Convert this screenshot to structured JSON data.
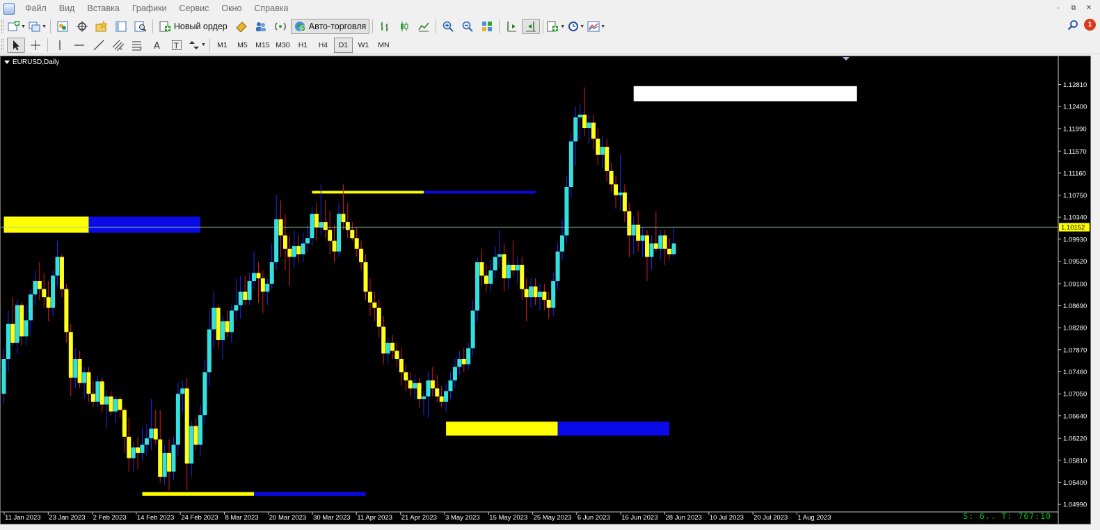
{
  "menu": {
    "items": [
      "Файл",
      "Вид",
      "Вставка",
      "Графики",
      "Сервис",
      "Окно",
      "Справка"
    ]
  },
  "window_controls": {
    "minimize": "–",
    "restore": "⧉",
    "close": "✕"
  },
  "toolbar": {
    "new_order_label": "Новый ордер",
    "auto_trading_label": "Авто-торговля",
    "notification_count": "1"
  },
  "timeframes": [
    "M1",
    "M5",
    "M15",
    "M30",
    "H1",
    "H4",
    "D1",
    "W1",
    "MN"
  ],
  "active_timeframe": "D1",
  "chart": {
    "title": "EURUSD,Daily",
    "status_readout": "S: 6.. T: 767:10"
  },
  "chart_data": {
    "type": "candlestick",
    "symbol": "EURUSD",
    "period": "Daily",
    "current_price": 1.10152,
    "current_price_label": "1.10152",
    "y_range": [
      1.0494,
      1.1318
    ],
    "y_ticks": [
      "1.12810",
      "1.12400",
      "1.11990",
      "1.11570",
      "1.11160",
      "1.10750",
      "1.10340",
      "1.09930",
      "1.09520",
      "1.09100",
      "1.08690",
      "1.08280",
      "1.07870",
      "1.07460",
      "1.07050",
      "1.06640",
      "1.06220",
      "1.05810",
      "1.05400",
      "1.04990"
    ],
    "x_ticks": [
      "11 Jan 2023",
      "23 Jan 2023",
      "2 Feb 2023",
      "14 Feb 2023",
      "24 Feb 2023",
      "8 Mar 2023",
      "20 Mar 2023",
      "30 Mar 2023",
      "11 Apr 2023",
      "21 Apr 2023",
      "3 May 2023",
      "15 May 2023",
      "25 May 2023",
      "6 Jun 2023",
      "16 Jun 2023",
      "28 Jun 2023",
      "10 Jul 2023",
      "20 Jul 2023",
      "1 Aug 2023"
    ],
    "colors": {
      "background": "#000000",
      "bull_body": "#33e0e0",
      "bear_body": "#ffff1a",
      "bull_wick": "#1a2bff",
      "bear_wick": "#e01a1a",
      "price_line": "#9ed49e",
      "zone_yellow": "#ffff00",
      "zone_blue": "#0a0ae6",
      "zone_white": "#ffffff",
      "readout": "#00c400"
    },
    "candles": [
      {
        "o": 1.0705,
        "h": 1.079,
        "l": 1.0685,
        "c": 1.077
      },
      {
        "o": 1.077,
        "h": 1.086,
        "l": 1.0745,
        "c": 1.0835
      },
      {
        "o": 1.0835,
        "h": 1.0885,
        "l": 1.0795,
        "c": 1.08
      },
      {
        "o": 1.08,
        "h": 1.088,
        "l": 1.078,
        "c": 1.087
      },
      {
        "o": 1.087,
        "h": 1.0875,
        "l": 1.0795,
        "c": 1.0812
      },
      {
        "o": 1.0812,
        "h": 1.087,
        "l": 1.0795,
        "c": 1.0842
      },
      {
        "o": 1.0842,
        "h": 1.09,
        "l": 1.0815,
        "c": 1.089
      },
      {
        "o": 1.089,
        "h": 1.0935,
        "l": 1.087,
        "c": 1.0915
      },
      {
        "o": 1.0915,
        "h": 1.095,
        "l": 1.088,
        "c": 1.09
      },
      {
        "o": 1.09,
        "h": 1.093,
        "l": 1.0865,
        "c": 1.0885
      },
      {
        "o": 1.0885,
        "h": 1.0915,
        "l": 1.084,
        "c": 1.0865
      },
      {
        "o": 1.0865,
        "h": 1.0935,
        "l": 1.085,
        "c": 1.0925
      },
      {
        "o": 1.0925,
        "h": 1.099,
        "l": 1.0905,
        "c": 1.096
      },
      {
        "o": 1.096,
        "h": 1.0965,
        "l": 1.0885,
        "c": 1.09
      },
      {
        "o": 1.09,
        "h": 1.091,
        "l": 1.08,
        "c": 1.082
      },
      {
        "o": 1.082,
        "h": 1.0835,
        "l": 1.07,
        "c": 1.0735
      },
      {
        "o": 1.0735,
        "h": 1.079,
        "l": 1.0715,
        "c": 1.077
      },
      {
        "o": 1.077,
        "h": 1.0785,
        "l": 1.0715,
        "c": 1.0725
      },
      {
        "o": 1.0725,
        "h": 1.0755,
        "l": 1.0695,
        "c": 1.0745
      },
      {
        "o": 1.0745,
        "h": 1.0755,
        "l": 1.069,
        "c": 1.0705
      },
      {
        "o": 1.0705,
        "h": 1.073,
        "l": 1.068,
        "c": 1.069
      },
      {
        "o": 1.069,
        "h": 1.074,
        "l": 1.068,
        "c": 1.0728
      },
      {
        "o": 1.0728,
        "h": 1.0735,
        "l": 1.067,
        "c": 1.0685
      },
      {
        "o": 1.0685,
        "h": 1.0712,
        "l": 1.064,
        "c": 1.07
      },
      {
        "o": 1.07,
        "h": 1.071,
        "l": 1.0665,
        "c": 1.0672
      },
      {
        "o": 1.0672,
        "h": 1.07,
        "l": 1.065,
        "c": 1.0695
      },
      {
        "o": 1.0695,
        "h": 1.07,
        "l": 1.066,
        "c": 1.0675
      },
      {
        "o": 1.0675,
        "h": 1.068,
        "l": 1.0595,
        "c": 1.0625
      },
      {
        "o": 1.0625,
        "h": 1.066,
        "l": 1.056,
        "c": 1.0585
      },
      {
        "o": 1.0585,
        "h": 1.0615,
        "l": 1.056,
        "c": 1.0605
      },
      {
        "o": 1.0605,
        "h": 1.0625,
        "l": 1.0565,
        "c": 1.0595
      },
      {
        "o": 1.0595,
        "h": 1.064,
        "l": 1.058,
        "c": 1.061
      },
      {
        "o": 1.061,
        "h": 1.065,
        "l": 1.059,
        "c": 1.0622
      },
      {
        "o": 1.0622,
        "h": 1.0695,
        "l": 1.06,
        "c": 1.064
      },
      {
        "o": 1.064,
        "h": 1.0675,
        "l": 1.061,
        "c": 1.062
      },
      {
        "o": 1.062,
        "h": 1.0675,
        "l": 1.054,
        "c": 1.055
      },
      {
        "o": 1.055,
        "h": 1.061,
        "l": 1.0535,
        "c": 1.0595
      },
      {
        "o": 1.0595,
        "h": 1.062,
        "l": 1.0525,
        "c": 1.056
      },
      {
        "o": 1.056,
        "h": 1.0625,
        "l": 1.0545,
        "c": 1.061
      },
      {
        "o": 1.061,
        "h": 1.0725,
        "l": 1.059,
        "c": 1.0705
      },
      {
        "o": 1.0705,
        "h": 1.073,
        "l": 1.067,
        "c": 1.0715
      },
      {
        "o": 1.0715,
        "h": 1.0735,
        "l": 1.0525,
        "c": 1.0575
      },
      {
        "o": 1.0575,
        "h": 1.0655,
        "l": 1.055,
        "c": 1.0645
      },
      {
        "o": 1.0645,
        "h": 1.066,
        "l": 1.06,
        "c": 1.061
      },
      {
        "o": 1.061,
        "h": 1.0685,
        "l": 1.059,
        "c": 1.0665
      },
      {
        "o": 1.0665,
        "h": 1.077,
        "l": 1.065,
        "c": 1.0745
      },
      {
        "o": 1.0745,
        "h": 1.086,
        "l": 1.072,
        "c": 1.0825
      },
      {
        "o": 1.0825,
        "h": 1.0895,
        "l": 1.079,
        "c": 1.0865
      },
      {
        "o": 1.0865,
        "h": 1.087,
        "l": 1.079,
        "c": 1.0805
      },
      {
        "o": 1.0805,
        "h": 1.085,
        "l": 1.077,
        "c": 1.084
      },
      {
        "o": 1.084,
        "h": 1.086,
        "l": 1.081,
        "c": 1.082
      },
      {
        "o": 1.082,
        "h": 1.087,
        "l": 1.08,
        "c": 1.086
      },
      {
        "o": 1.086,
        "h": 1.092,
        "l": 1.084,
        "c": 1.087
      },
      {
        "o": 1.087,
        "h": 1.0925,
        "l": 1.0845,
        "c": 1.0895
      },
      {
        "o": 1.0895,
        "h": 1.0925,
        "l": 1.087,
        "c": 1.088
      },
      {
        "o": 1.088,
        "h": 1.093,
        "l": 1.087,
        "c": 1.0915
      },
      {
        "o": 1.0915,
        "h": 1.097,
        "l": 1.09,
        "c": 1.093
      },
      {
        "o": 1.093,
        "h": 1.095,
        "l": 1.0875,
        "c": 1.092
      },
      {
        "o": 1.092,
        "h": 1.0935,
        "l": 1.0855,
        "c": 1.0895
      },
      {
        "o": 1.0895,
        "h": 1.092,
        "l": 1.087,
        "c": 1.091
      },
      {
        "o": 1.091,
        "h": 1.0985,
        "l": 1.09,
        "c": 1.095
      },
      {
        "o": 1.095,
        "h": 1.1075,
        "l": 1.0935,
        "c": 1.103
      },
      {
        "o": 1.103,
        "h": 1.1065,
        "l": 1.096,
        "c": 1.1
      },
      {
        "o": 1.1,
        "h": 1.104,
        "l": 1.0935,
        "c": 1.0975
      },
      {
        "o": 1.0975,
        "h": 1.1,
        "l": 1.0905,
        "c": 1.096
      },
      {
        "o": 1.096,
        "h": 1.101,
        "l": 1.094,
        "c": 1.098
      },
      {
        "o": 1.098,
        "h": 1.1,
        "l": 1.095,
        "c": 1.0965
      },
      {
        "o": 1.0965,
        "h": 1.1005,
        "l": 1.095,
        "c": 1.0985
      },
      {
        "o": 1.0985,
        "h": 1.102,
        "l": 1.097,
        "c": 1.0995
      },
      {
        "o": 1.0995,
        "h": 1.1055,
        "l": 1.098,
        "c": 1.104
      },
      {
        "o": 1.104,
        "h": 1.106,
        "l": 1.099,
        "c": 1.1015
      },
      {
        "o": 1.1015,
        "h": 1.1095,
        "l": 1.1,
        "c": 1.1025
      },
      {
        "o": 1.1025,
        "h": 1.1065,
        "l": 1.0995,
        "c": 1.101
      },
      {
        "o": 1.101,
        "h": 1.1045,
        "l": 1.0965,
        "c": 1.099
      },
      {
        "o": 1.099,
        "h": 1.102,
        "l": 1.095,
        "c": 1.097
      },
      {
        "o": 1.097,
        "h": 1.106,
        "l": 1.096,
        "c": 1.104
      },
      {
        "o": 1.104,
        "h": 1.1095,
        "l": 1.101,
        "c": 1.1025
      },
      {
        "o": 1.1025,
        "h": 1.106,
        "l": 1.0995,
        "c": 1.101
      },
      {
        "o": 1.101,
        "h": 1.1025,
        "l": 1.099,
        "c": 1.0995
      },
      {
        "o": 1.0995,
        "h": 1.1015,
        "l": 1.096,
        "c": 1.0975
      },
      {
        "o": 1.0975,
        "h": 1.099,
        "l": 1.0935,
        "c": 1.095
      },
      {
        "o": 1.095,
        "h": 1.0965,
        "l": 1.088,
        "c": 1.0895
      },
      {
        "o": 1.0895,
        "h": 1.092,
        "l": 1.085,
        "c": 1.0875
      },
      {
        "o": 1.0875,
        "h": 1.0895,
        "l": 1.084,
        "c": 1.0865
      },
      {
        "o": 1.0865,
        "h": 1.088,
        "l": 1.081,
        "c": 1.083
      },
      {
        "o": 1.083,
        "h": 1.085,
        "l": 1.076,
        "c": 1.078
      },
      {
        "o": 1.078,
        "h": 1.081,
        "l": 1.076,
        "c": 1.08
      },
      {
        "o": 1.08,
        "h": 1.0815,
        "l": 1.077,
        "c": 1.0785
      },
      {
        "o": 1.0785,
        "h": 1.08,
        "l": 1.0755,
        "c": 1.077
      },
      {
        "o": 1.077,
        "h": 1.079,
        "l": 1.072,
        "c": 1.0745
      },
      {
        "o": 1.0745,
        "h": 1.076,
        "l": 1.071,
        "c": 1.073
      },
      {
        "o": 1.073,
        "h": 1.0745,
        "l": 1.07,
        "c": 1.0715
      },
      {
        "o": 1.0715,
        "h": 1.074,
        "l": 1.0695,
        "c": 1.0725
      },
      {
        "o": 1.0725,
        "h": 1.0735,
        "l": 1.068,
        "c": 1.0695
      },
      {
        "o": 1.0695,
        "h": 1.071,
        "l": 1.0665,
        "c": 1.07
      },
      {
        "o": 1.07,
        "h": 1.0745,
        "l": 1.066,
        "c": 1.073
      },
      {
        "o": 1.073,
        "h": 1.0755,
        "l": 1.07,
        "c": 1.0715
      },
      {
        "o": 1.0715,
        "h": 1.074,
        "l": 1.069,
        "c": 1.07
      },
      {
        "o": 1.07,
        "h": 1.072,
        "l": 1.068,
        "c": 1.069
      },
      {
        "o": 1.069,
        "h": 1.0725,
        "l": 1.067,
        "c": 1.071
      },
      {
        "o": 1.071,
        "h": 1.0745,
        "l": 1.0695,
        "c": 1.073
      },
      {
        "o": 1.073,
        "h": 1.077,
        "l": 1.0715,
        "c": 1.0755
      },
      {
        "o": 1.0755,
        "h": 1.0785,
        "l": 1.074,
        "c": 1.077
      },
      {
        "o": 1.077,
        "h": 1.079,
        "l": 1.0745,
        "c": 1.076
      },
      {
        "o": 1.076,
        "h": 1.08,
        "l": 1.075,
        "c": 1.079
      },
      {
        "o": 1.079,
        "h": 1.088,
        "l": 1.0775,
        "c": 1.086
      },
      {
        "o": 1.086,
        "h": 1.096,
        "l": 1.084,
        "c": 1.095
      },
      {
        "o": 1.095,
        "h": 1.0975,
        "l": 1.0905,
        "c": 1.0925
      },
      {
        "o": 1.0925,
        "h": 1.0945,
        "l": 1.0895,
        "c": 1.091
      },
      {
        "o": 1.091,
        "h": 1.0955,
        "l": 1.0895,
        "c": 1.0935
      },
      {
        "o": 1.0935,
        "h": 1.098,
        "l": 1.092,
        "c": 1.096
      },
      {
        "o": 1.096,
        "h": 1.101,
        "l": 1.094,
        "c": 1.0965
      },
      {
        "o": 1.0965,
        "h": 1.0985,
        "l": 1.0895,
        "c": 1.092
      },
      {
        "o": 1.092,
        "h": 1.0955,
        "l": 1.09,
        "c": 1.0945
      },
      {
        "o": 1.0945,
        "h": 1.099,
        "l": 1.0925,
        "c": 1.0935
      },
      {
        "o": 1.0935,
        "h": 1.096,
        "l": 1.091,
        "c": 1.0945
      },
      {
        "o": 1.0945,
        "h": 1.096,
        "l": 1.088,
        "c": 1.09
      },
      {
        "o": 1.09,
        "h": 1.092,
        "l": 1.084,
        "c": 1.0885
      },
      {
        "o": 1.0885,
        "h": 1.092,
        "l": 1.0865,
        "c": 1.0905
      },
      {
        "o": 1.0905,
        "h": 1.092,
        "l": 1.087,
        "c": 1.0885
      },
      {
        "o": 1.0885,
        "h": 1.091,
        "l": 1.086,
        "c": 1.0895
      },
      {
        "o": 1.0895,
        "h": 1.091,
        "l": 1.086,
        "c": 1.088
      },
      {
        "o": 1.088,
        "h": 1.0895,
        "l": 1.0845,
        "c": 1.0865
      },
      {
        "o": 1.0865,
        "h": 1.093,
        "l": 1.085,
        "c": 1.0915
      },
      {
        "o": 1.0915,
        "h": 1.0985,
        "l": 1.09,
        "c": 1.097
      },
      {
        "o": 1.097,
        "h": 1.103,
        "l": 1.0955,
        "c": 1.1
      },
      {
        "o": 1.1,
        "h": 1.111,
        "l": 1.0985,
        "c": 1.109
      },
      {
        "o": 1.109,
        "h": 1.119,
        "l": 1.107,
        "c": 1.1175
      },
      {
        "o": 1.1175,
        "h": 1.124,
        "l": 1.113,
        "c": 1.122
      },
      {
        "o": 1.122,
        "h": 1.1245,
        "l": 1.118,
        "c": 1.1225
      },
      {
        "o": 1.1225,
        "h": 1.1276,
        "l": 1.1185,
        "c": 1.12
      },
      {
        "o": 1.12,
        "h": 1.1225,
        "l": 1.117,
        "c": 1.121
      },
      {
        "o": 1.121,
        "h": 1.1225,
        "l": 1.116,
        "c": 1.118
      },
      {
        "o": 1.118,
        "h": 1.12,
        "l": 1.113,
        "c": 1.115
      },
      {
        "o": 1.115,
        "h": 1.1185,
        "l": 1.1125,
        "c": 1.1165
      },
      {
        "o": 1.1165,
        "h": 1.118,
        "l": 1.11,
        "c": 1.112
      },
      {
        "o": 1.112,
        "h": 1.1135,
        "l": 1.108,
        "c": 1.1095
      },
      {
        "o": 1.1095,
        "h": 1.111,
        "l": 1.105,
        "c": 1.1075
      },
      {
        "o": 1.1075,
        "h": 1.115,
        "l": 1.1045,
        "c": 1.108
      },
      {
        "o": 1.108,
        "h": 1.1095,
        "l": 1.1025,
        "c": 1.1045
      },
      {
        "o": 1.1045,
        "h": 1.106,
        "l": 1.096,
        "c": 1.1
      },
      {
        "o": 1.1,
        "h": 1.1035,
        "l": 1.0965,
        "c": 1.102
      },
      {
        "o": 1.102,
        "h": 1.1045,
        "l": 1.097,
        "c": 1.099
      },
      {
        "o": 1.099,
        "h": 1.1015,
        "l": 1.096,
        "c": 1.1
      },
      {
        "o": 1.1,
        "h": 1.101,
        "l": 1.0915,
        "c": 1.096
      },
      {
        "o": 1.096,
        "h": 1.1,
        "l": 1.0935,
        "c": 1.0985
      },
      {
        "o": 1.0985,
        "h": 1.1045,
        "l": 1.097,
        "c": 1.0975
      },
      {
        "o": 1.0975,
        "h": 1.101,
        "l": 1.0955,
        "c": 1.1
      },
      {
        "o": 1.1,
        "h": 1.101,
        "l": 1.0945,
        "c": 1.0975
      },
      {
        "o": 1.0975,
        "h": 1.0995,
        "l": 1.0955,
        "c": 1.0965
      },
      {
        "o": 1.0965,
        "h": 1.1015,
        "l": 1.096,
        "c": 1.0985
      }
    ],
    "zones": [
      {
        "color": "yellow",
        "start": 0,
        "end": 19,
        "top": 1.1035,
        "bottom": 1.1005
      },
      {
        "color": "blue",
        "start": 19,
        "end": 44,
        "top": 1.1035,
        "bottom": 1.1005
      },
      {
        "color": "yellow",
        "start": 69,
        "end": 94,
        "top": 1.1083,
        "bottom": 1.1078
      },
      {
        "color": "blue",
        "start": 94,
        "end": 119,
        "top": 1.1083,
        "bottom": 1.1078
      },
      {
        "color": "yellow",
        "start": 99,
        "end": 124,
        "top": 1.0653,
        "bottom": 1.0627
      },
      {
        "color": "blue",
        "start": 124,
        "end": 149,
        "top": 1.0653,
        "bottom": 1.0627
      },
      {
        "color": "yellow",
        "start": 31,
        "end": 56,
        "top": 1.0522,
        "bottom": 1.0515
      },
      {
        "color": "blue",
        "start": 56,
        "end": 81,
        "top": 1.0522,
        "bottom": 1.0515
      },
      {
        "color": "white",
        "start": 141,
        "end": 191,
        "top": 1.1278,
        "bottom": 1.125
      }
    ]
  }
}
